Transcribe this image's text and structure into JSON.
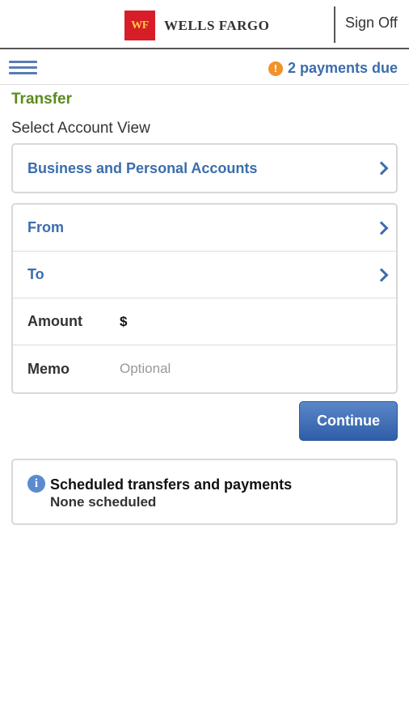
{
  "header": {
    "logo_mark": "WF",
    "brand": "WELLS FARGO",
    "sign_off": "Sign Off"
  },
  "subbar": {
    "menu_icon": "hamburger-icon",
    "alert_icon": "exclamation-circle-icon",
    "alert_symbol": "!",
    "payments_due": "2 payments due",
    "accent_color": "#3b6dad",
    "alert_color": "#f0932b"
  },
  "page": {
    "title": "Transfer",
    "title_color": "#5a8a1e",
    "account_view_label": "Select Account View",
    "account_view_value": "Business and Personal Accounts"
  },
  "form": {
    "from_label": "From",
    "to_label": "To",
    "amount_label": "Amount",
    "amount_prefix": "$",
    "amount_value": "",
    "memo_label": "Memo",
    "memo_placeholder": "Optional",
    "continue_label": "Continue"
  },
  "scheduled": {
    "icon": "info-icon",
    "icon_symbol": "i",
    "title": "Scheduled transfers and payments",
    "status": "None scheduled"
  }
}
